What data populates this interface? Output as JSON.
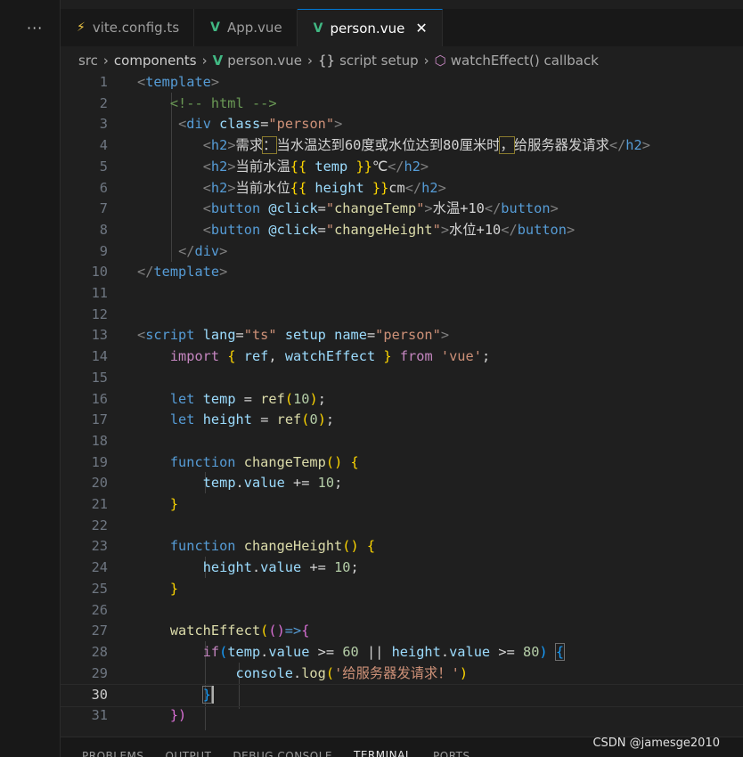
{
  "activity": {
    "more_icon": "···"
  },
  "tabs": [
    {
      "label": "vite.config.ts",
      "icon": "lightning-icon"
    },
    {
      "label": "App.vue",
      "icon": "vue-icon"
    },
    {
      "label": "person.vue",
      "icon": "vue-icon",
      "active": true
    }
  ],
  "close_glyph": "✕",
  "breadcrumb": [
    "src",
    "components",
    "person.vue",
    "script setup",
    "watchEffect() callback"
  ],
  "code_lines": [
    {
      "n": "1",
      "html": "<span class='t-pun'>&lt;</span><span class='t-tag'>template</span><span class='t-pun'>&gt;</span>"
    },
    {
      "n": "2",
      "html": "    <span class='t-com'>&lt;!-- html --&gt;</span>"
    },
    {
      "n": "3",
      "html": "     <span class='t-pun'>&lt;</span><span class='t-tag'>div</span> <span class='t-attr'>class</span><span class='t-txt'>=</span><span class='t-str'>\"person\"</span><span class='t-pun'>&gt;</span>"
    },
    {
      "n": "4",
      "html": "        <span class='t-pun'>&lt;</span><span class='t-tag'>h2</span><span class='t-pun'>&gt;</span><span class='t-txt'>需求<span class='hl-box'>：</span>当水温达到60度或水位达到80厘米时<span class='hl-box'>，</span>给服务器发请求</span><span class='t-pun'>&lt;/</span><span class='t-tag'>h2</span><span class='t-pun'>&gt;</span>"
    },
    {
      "n": "5",
      "html": "        <span class='t-pun'>&lt;</span><span class='t-tag'>h2</span><span class='t-pun'>&gt;</span><span class='t-txt'>当前水温</span><span class='t-b1'>{{</span> <span class='t-var'>temp</span> <span class='t-b1'>}}</span><span class='t-txt'>℃</span><span class='t-pun'>&lt;/</span><span class='t-tag'>h2</span><span class='t-pun'>&gt;</span>"
    },
    {
      "n": "6",
      "html": "        <span class='t-pun'>&lt;</span><span class='t-tag'>h2</span><span class='t-pun'>&gt;</span><span class='t-txt'>当前水位</span><span class='t-b1'>{{</span> <span class='t-var'>height</span> <span class='t-b1'>}}</span><span class='t-txt'>cm</span><span class='t-pun'>&lt;/</span><span class='t-tag'>h2</span><span class='t-pun'>&gt;</span>"
    },
    {
      "n": "7",
      "html": "        <span class='t-pun'>&lt;</span><span class='t-tag'>button</span> <span class='t-attr'>@click</span><span class='t-txt'>=</span><span class='t-str'>\"</span><span class='t-fn'>changeTemp</span><span class='t-str'>\"</span><span class='t-pun'>&gt;</span><span class='t-txt'>水温+10</span><span class='t-pun'>&lt;/</span><span class='t-tag'>button</span><span class='t-pun'>&gt;</span>"
    },
    {
      "n": "8",
      "html": "        <span class='t-pun'>&lt;</span><span class='t-tag'>button</span> <span class='t-attr'>@click</span><span class='t-txt'>=</span><span class='t-str'>\"</span><span class='t-fn'>changeHeight</span><span class='t-str'>\"</span><span class='t-pun'>&gt;</span><span class='t-txt'>水位+10</span><span class='t-pun'>&lt;/</span><span class='t-tag'>button</span><span class='t-pun'>&gt;</span>"
    },
    {
      "n": "9",
      "html": "     <span class='t-pun'>&lt;/</span><span class='t-tag'>div</span><span class='t-pun'>&gt;</span>"
    },
    {
      "n": "10",
      "html": "<span class='t-pun'>&lt;/</span><span class='t-tag'>template</span><span class='t-pun'>&gt;</span>"
    },
    {
      "n": "11",
      "html": ""
    },
    {
      "n": "12",
      "html": ""
    },
    {
      "n": "13",
      "html": "<span class='t-pun'>&lt;</span><span class='t-tag'>script</span> <span class='t-attr'>lang</span><span class='t-txt'>=</span><span class='t-str'>\"ts\"</span> <span class='t-attr'>setup</span> <span class='t-attr'>name</span><span class='t-txt'>=</span><span class='t-str'>\"person\"</span><span class='t-pun'>&gt;</span>"
    },
    {
      "n": "14",
      "html": "    <span class='t-kw2'>import</span> <span class='t-b1'>{</span> <span class='t-var'>ref</span><span class='t-txt'>,</span> <span class='t-var'>watchEffect</span> <span class='t-b1'>}</span> <span class='t-kw2'>from</span> <span class='t-str'>'vue'</span><span class='t-txt'>;</span>"
    },
    {
      "n": "15",
      "html": ""
    },
    {
      "n": "16",
      "html": "    <span class='t-kw'>let</span> <span class='t-var'>temp</span> <span class='t-txt'>=</span> <span class='t-fn'>ref</span><span class='t-b1'>(</span><span class='t-num'>10</span><span class='t-b1'>)</span><span class='t-txt'>;</span>"
    },
    {
      "n": "17",
      "html": "    <span class='t-kw'>let</span> <span class='t-var'>height</span> <span class='t-txt'>=</span> <span class='t-fn'>ref</span><span class='t-b1'>(</span><span class='t-num'>0</span><span class='t-b1'>)</span><span class='t-txt'>;</span>"
    },
    {
      "n": "18",
      "html": ""
    },
    {
      "n": "19",
      "html": "    <span class='t-kw'>function</span> <span class='t-fn'>changeTemp</span><span class='t-b1'>()</span> <span class='t-b1'>{</span>"
    },
    {
      "n": "20",
      "html": "        <span class='t-var'>temp</span><span class='t-txt'>.</span><span class='t-var'>value</span> <span class='t-txt'>+=</span> <span class='t-num'>10</span><span class='t-txt'>;</span>"
    },
    {
      "n": "21",
      "html": "    <span class='t-b1'>}</span>"
    },
    {
      "n": "22",
      "html": ""
    },
    {
      "n": "23",
      "html": "    <span class='t-kw'>function</span> <span class='t-fn'>changeHeight</span><span class='t-b1'>()</span> <span class='t-b1'>{</span>"
    },
    {
      "n": "24",
      "html": "        <span class='t-var'>height</span><span class='t-txt'>.</span><span class='t-var'>value</span> <span class='t-txt'>+=</span> <span class='t-num'>10</span><span class='t-txt'>;</span>"
    },
    {
      "n": "25",
      "html": "    <span class='t-b1'>}</span>"
    },
    {
      "n": "26",
      "html": ""
    },
    {
      "n": "27",
      "html": "    <span class='t-fn'>watchEffect</span><span class='t-b1'>(</span><span class='t-b2'>()</span><span class='t-kw'>=&gt;</span><span class='t-b2'>{</span>"
    },
    {
      "n": "28",
      "html": "        <span class='t-kw2'>if</span><span class='t-b3'>(</span><span class='t-var'>temp</span><span class='t-txt'>.</span><span class='t-var'>value</span> <span class='t-txt'>&gt;=</span> <span class='t-num'>60</span> <span class='t-txt'>||</span> <span class='t-var'>height</span><span class='t-txt'>.</span><span class='t-var'>value</span> <span class='t-txt'>&gt;=</span> <span class='t-num'>80</span><span class='t-b3'>)</span> <span class='t-b3' style='outline:1px solid #6e6e6e'>{</span>"
    },
    {
      "n": "29",
      "html": "            <span class='t-var'>console</span><span class='t-txt'>.</span><span class='t-fn'>log</span><span class='t-b1'>(</span><span class='t-str'>'给服务器发请求！'</span><span class='t-b1'>)</span>"
    },
    {
      "n": "30",
      "html": "        <span class='t-b3' style='outline:1px solid #6e6e6e'>}</span>",
      "active": true
    },
    {
      "n": "31",
      "html": "    <span class='t-b2'>})</span>"
    }
  ],
  "panel_tabs": [
    "PROBLEMS",
    "OUTPUT",
    "DEBUG CONSOLE",
    "TERMINAL",
    "PORTS"
  ],
  "active_panel_tab": "TERMINAL",
  "watermark": "CSDN @jamesge2010",
  "colors": {
    "vue_green": "#41b883",
    "accent": "#0078d4"
  }
}
